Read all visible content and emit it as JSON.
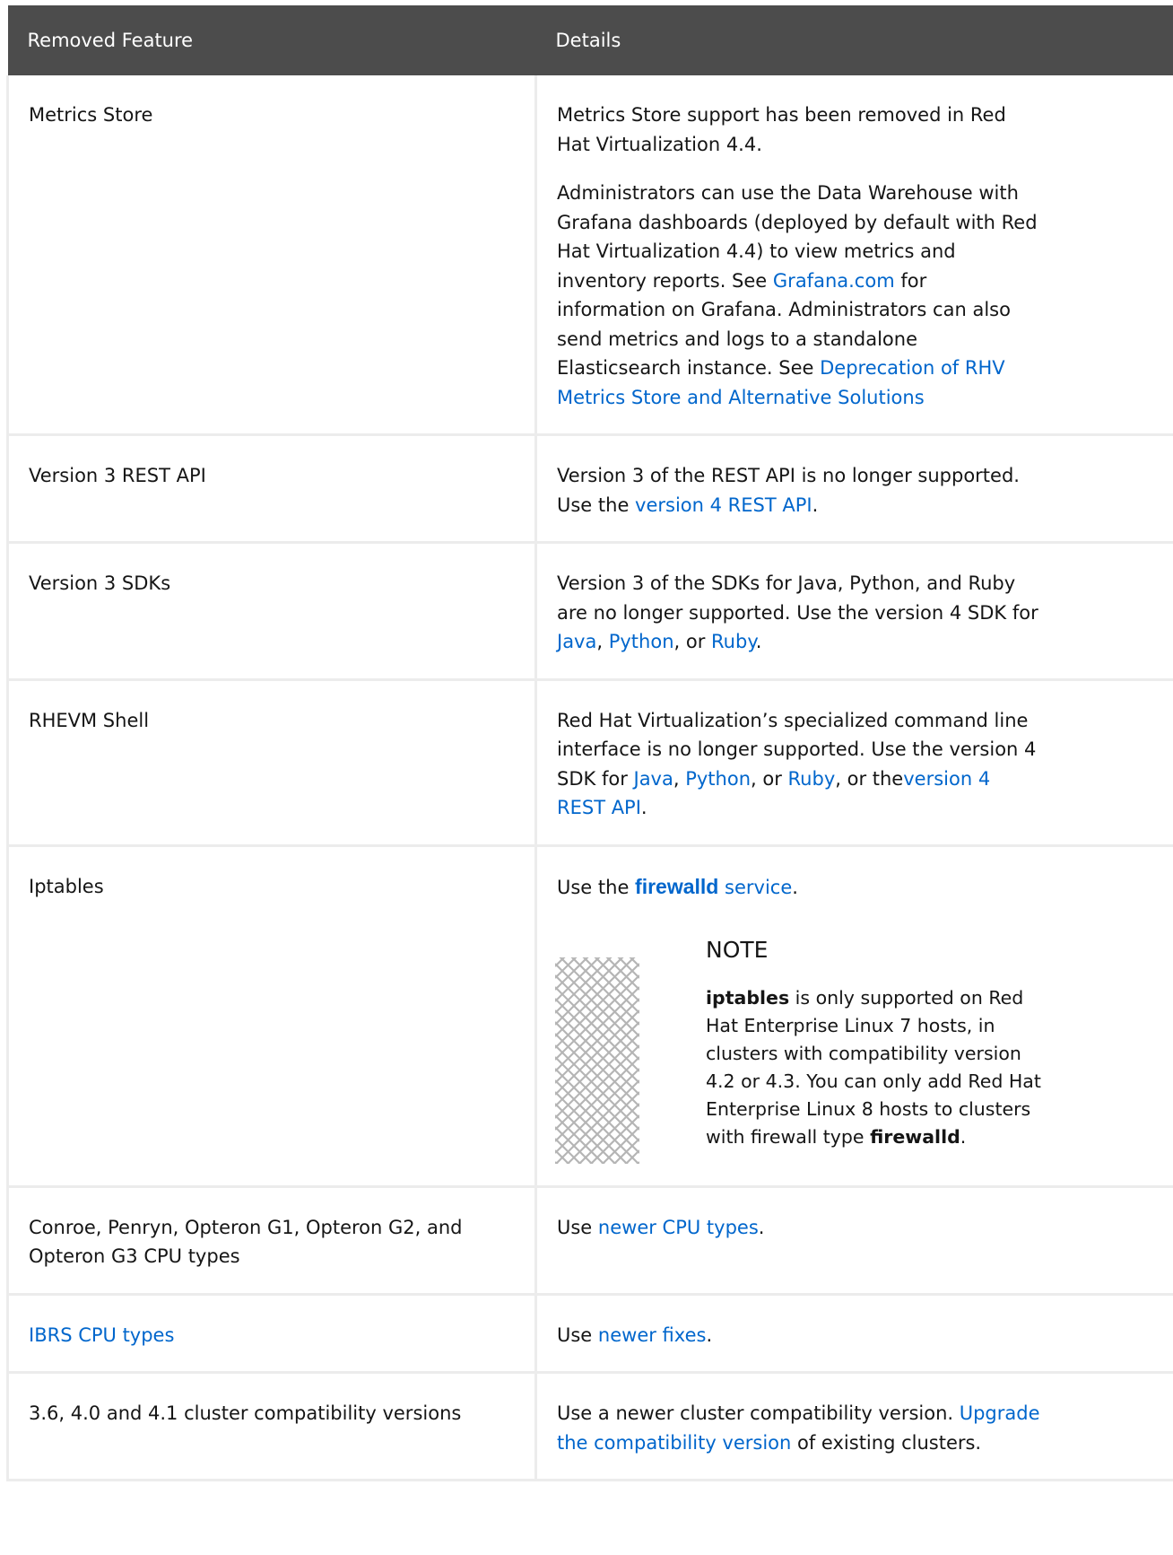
{
  "table": {
    "headers": [
      "Removed Feature",
      "Details"
    ],
    "rows": {
      "metrics": {
        "feature": "Metrics Store",
        "p1": "Metrics Store support has been removed in Red Hat Virtualization 4.4.",
        "p2_a": "Administrators can use the Data Warehouse with Grafana dashboards (deployed by default with Red Hat Virtualization 4.4) to view metrics and inventory reports. See ",
        "p2_link1": "Grafana.com",
        "p2_b": " for information on Grafana. Administrators can also send metrics and logs to a standalone Elasticsearch instance. See ",
        "p2_link2": "Deprecation of RHV Metrics Store and Alternative Solutions"
      },
      "restapi": {
        "feature": "Version 3 REST API",
        "text_a": "Version 3 of the REST API is no longer supported. Use the ",
        "link": "version 4 REST API",
        "text_b": "."
      },
      "sdks": {
        "feature": "Version 3 SDKs",
        "text_a": "Version 3 of the SDKs for Java, Python, and Ruby are no longer supported. Use the version 4 SDK for ",
        "link_java": "Java",
        "sep1": ", ",
        "link_python": "Python",
        "sep2": ", or ",
        "link_ruby": "Ruby",
        "text_b": "."
      },
      "shell": {
        "feature": "RHEVM Shell",
        "text_a": "Red Hat Virtualization’s specialized command line interface is no longer supported. Use the version 4 SDK for ",
        "link_java": "Java",
        "sep1": ", ",
        "link_python": "Python",
        "sep2": ", or ",
        "link_ruby": "Ruby",
        "sep3": ", or the",
        "link_api": "version 4 REST API",
        "text_b": "."
      },
      "iptables": {
        "feature": "Iptables",
        "text_a": "Use the ",
        "link_code": "firewalld",
        "link_rest": " service",
        "text_b": ".",
        "note_title": "NOTE",
        "note_b1": "iptables",
        "note_t1": " is only supported on Red Hat Enterprise Linux 7 hosts, in clusters with compatibility version 4.2 or 4.3. You can only add Red Hat Enterprise Linux 8 hosts to clusters with firewall type ",
        "note_b2": "firewalld",
        "note_t2": "."
      },
      "cpu": {
        "feature": "Conroe, Penryn, Opteron G1, Opteron G2, and Opteron G3 CPU types",
        "text_a": "Use ",
        "link": "newer CPU types",
        "text_b": "."
      },
      "ibrs": {
        "feature_link": "IBRS CPU types",
        "text_a": "Use ",
        "link": "newer fixes",
        "text_b": "."
      },
      "compat": {
        "feature": "3.6, 4.0 and 4.1 cluster compatibility versions",
        "text_a": "Use a newer cluster compatibility version. ",
        "link": "Upgrade the compatibility version",
        "text_b": " of existing clusters."
      }
    }
  },
  "colors": {
    "header_bg": "#4c4c4c",
    "link": "#0066cc",
    "border": "#ececec"
  },
  "icons": {
    "note": "note-pattern-icon"
  }
}
